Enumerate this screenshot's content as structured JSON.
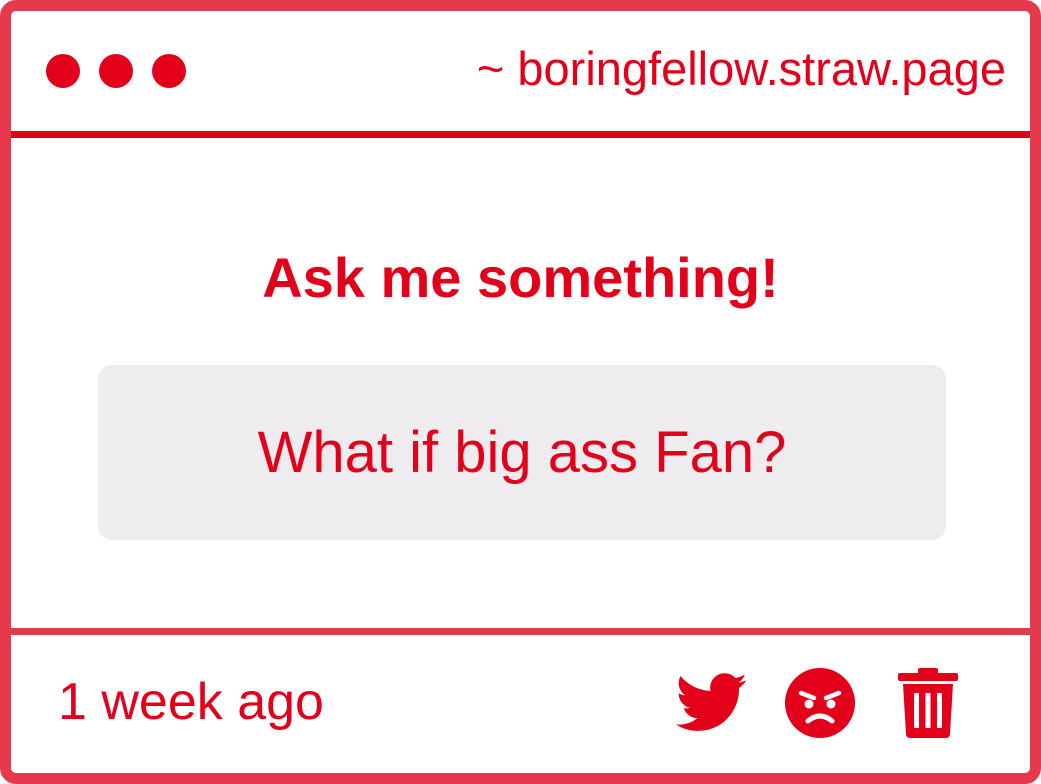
{
  "window": {
    "url": "~ boringfellow.straw.page"
  },
  "main": {
    "heading": "Ask me something!",
    "question": "What if big ass Fan?"
  },
  "footer": {
    "timestamp": "1 week ago",
    "actions": [
      {
        "icon": "twitter-icon"
      },
      {
        "icon": "angry-face-icon"
      },
      {
        "icon": "trash-icon"
      }
    ]
  },
  "colors": {
    "accent": "#e2001a",
    "border": "#e43a4c",
    "question_bg": "#eeecee",
    "background": "#ffffff"
  }
}
